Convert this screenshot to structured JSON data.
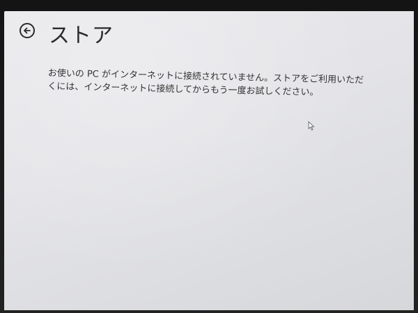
{
  "app": {
    "title": "ストア"
  },
  "header": {
    "back_icon": "back-arrow-circle-icon"
  },
  "main": {
    "message": "お使いの PC がインターネットに接続されていません。ストアをご利用いただくには、インターネットに接続してからもう一度お試しください。"
  },
  "colors": {
    "screen_background": "#e6e6e9",
    "text": "#333333",
    "title": "#2b2b2b"
  }
}
